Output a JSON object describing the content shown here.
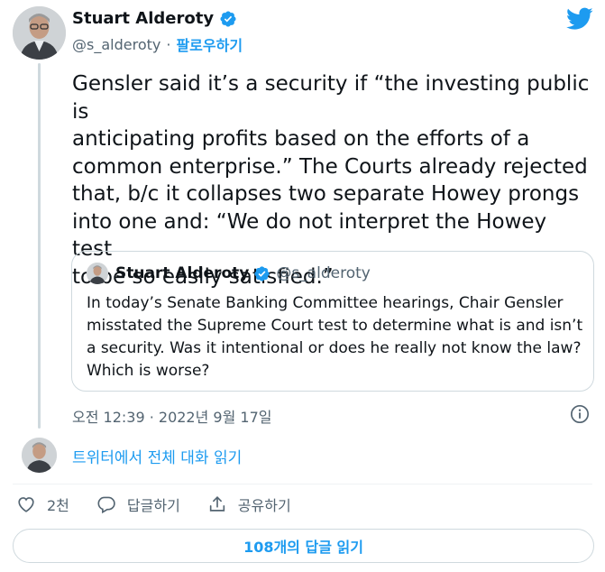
{
  "tweet": {
    "author_name": "Stuart Alderoty",
    "handle": "@s_alderoty",
    "separator": "·",
    "follow_label": "팔로우하기",
    "text": "Gensler said it’s a security if “the investing public is\nanticipating profits based on the efforts of a\ncommon enterprise.” The Courts already rejected\nthat, b/c it collapses two separate Howey prongs\ninto one and: “We do not interpret the Howey test\nto be so easily satisfied.”",
    "timestamp": "오전 12:39 · 2022년 9월 17일"
  },
  "quoted_tweet": {
    "author_name": "Stuart Alderoty",
    "handle": "@s_alderoty",
    "text": "In today’s Senate Banking Committee hearings, Chair Gensler misstated the Supreme Court test to determine what is and isn’t a security. Was it intentional or does he really not know the law? Which is worse?"
  },
  "thread": {
    "read_thread_label": "트위터에서 전체 대화 읽기"
  },
  "actions": {
    "like_count": "2천",
    "reply_label": "답글하기",
    "share_label": "공유하기"
  },
  "read_replies_label": "108개의 답글 읽기",
  "icons": {
    "verified": "verified-badge-icon",
    "brand": "twitter-bird-icon",
    "info": "info-icon",
    "like": "heart-icon",
    "reply": "reply-bubble-icon",
    "share": "share-upload-icon"
  },
  "colors": {
    "accent": "#1d9bf0",
    "text": "#0f1419",
    "secondary": "#536471",
    "border": "#cfd9de"
  }
}
